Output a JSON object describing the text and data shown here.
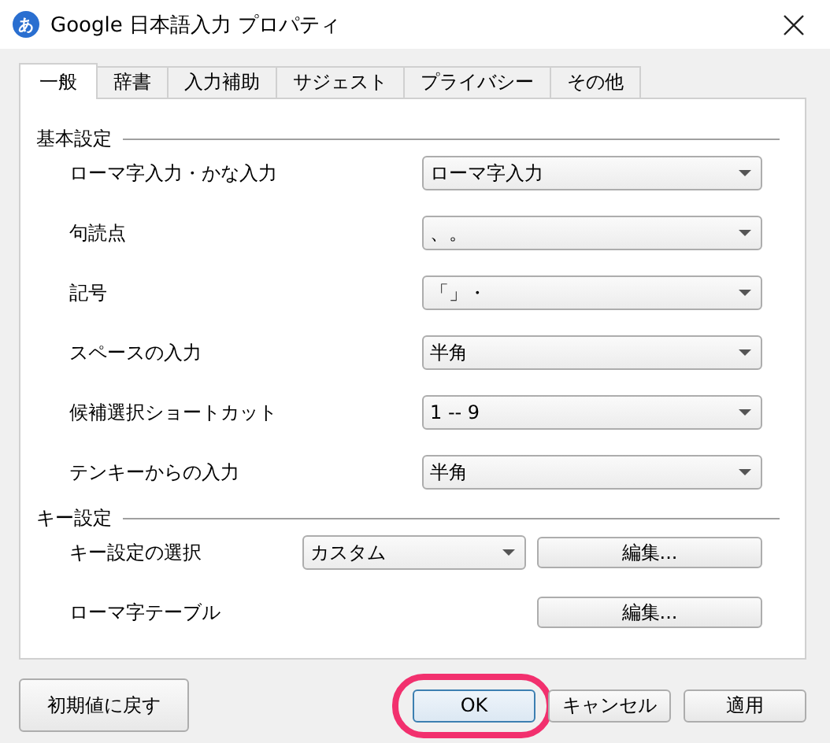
{
  "window": {
    "icon_glyph": "あ",
    "title": "Google 日本語入力 プロパティ"
  },
  "tabs": [
    {
      "label": "一般",
      "selected": true
    },
    {
      "label": "辞書",
      "selected": false
    },
    {
      "label": "入力補助",
      "selected": false
    },
    {
      "label": "サジェスト",
      "selected": false
    },
    {
      "label": "プライバシー",
      "selected": false
    },
    {
      "label": "その他",
      "selected": false
    }
  ],
  "sections": [
    {
      "title": "基本設定",
      "rows": [
        {
          "kind": "select",
          "label": "ローマ字入力・かな入力",
          "value": "ローマ字入力"
        },
        {
          "kind": "select",
          "label": "句読点",
          "value": "、。"
        },
        {
          "kind": "select",
          "label": "記号",
          "value": "「」・"
        },
        {
          "kind": "select",
          "label": "スペースの入力",
          "value": "半角"
        },
        {
          "kind": "select",
          "label": "候補選択ショートカット",
          "value": "1 -- 9"
        },
        {
          "kind": "select",
          "label": "テンキーからの入力",
          "value": "半角"
        }
      ]
    },
    {
      "title": "キー設定",
      "rows": [
        {
          "kind": "select_button",
          "label": "キー設定の選択",
          "value": "カスタム",
          "button": "編集..."
        },
        {
          "kind": "button",
          "label": "ローマ字テーブル",
          "button": "編集..."
        }
      ]
    }
  ],
  "reset_button": "初期値に戻す",
  "buttons": [
    {
      "label": "OK",
      "default": true,
      "highlighted": true
    },
    {
      "label": "キャンセル",
      "default": false,
      "highlighted": false
    },
    {
      "label": "適用",
      "default": false,
      "highlighted": false
    }
  ]
}
